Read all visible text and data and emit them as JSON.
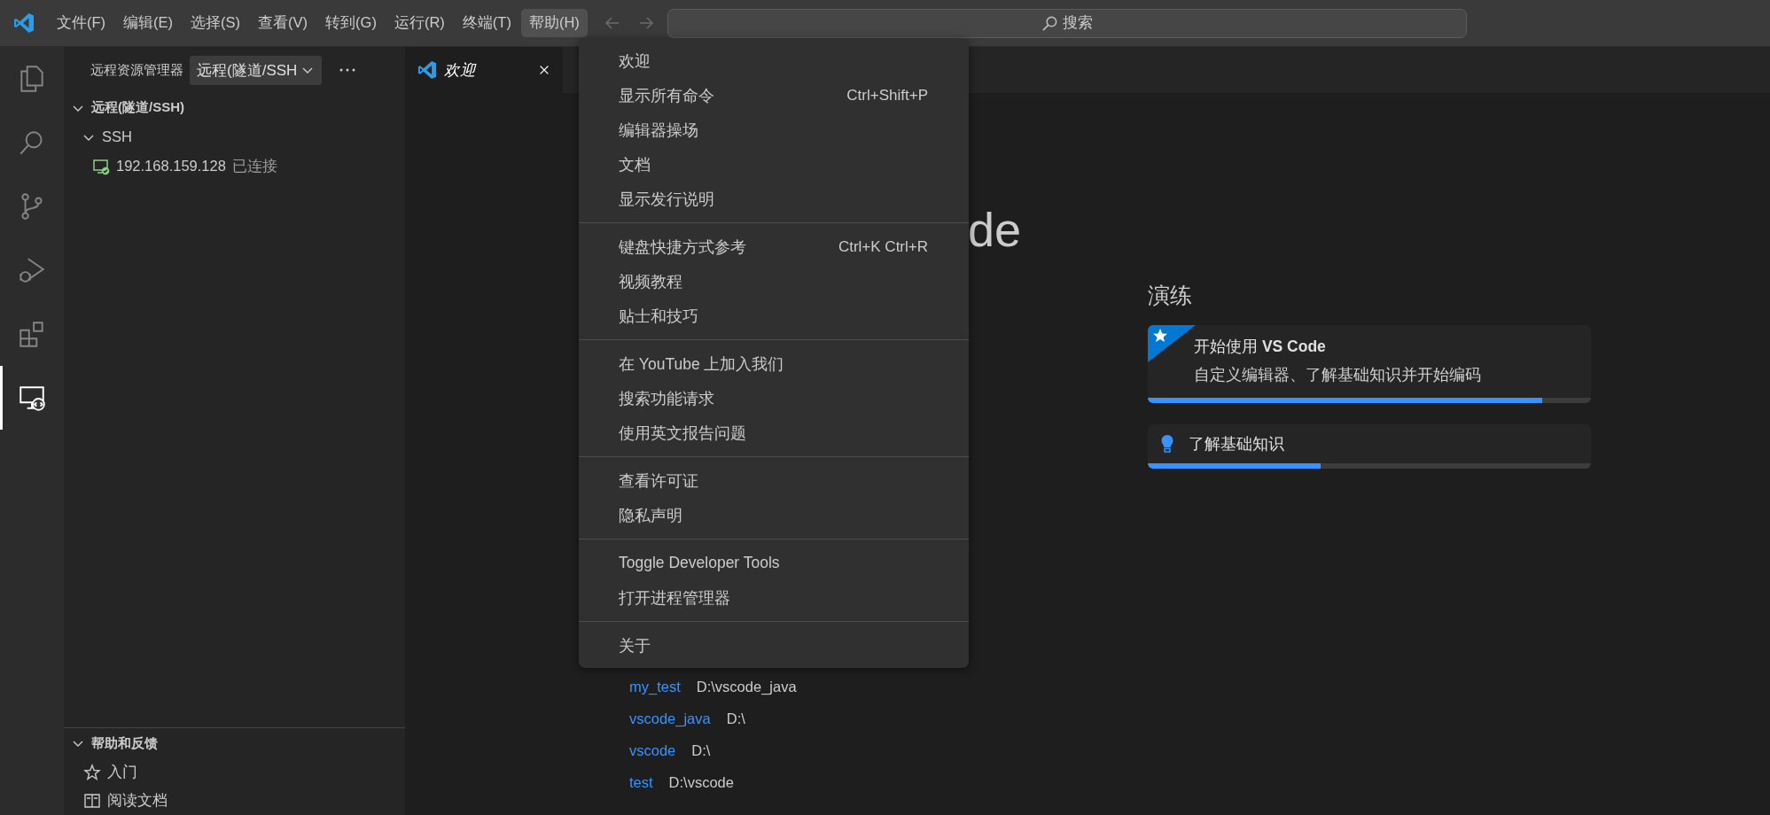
{
  "menu_bar": {
    "items": [
      {
        "label": "文件(F)",
        "selected": false
      },
      {
        "label": "编辑(E)",
        "selected": false
      },
      {
        "label": "选择(S)",
        "selected": false
      },
      {
        "label": "查看(V)",
        "selected": false
      },
      {
        "label": "转到(G)",
        "selected": false
      },
      {
        "label": "运行(R)",
        "selected": false
      },
      {
        "label": "终端(T)",
        "selected": false
      },
      {
        "label": "帮助(H)",
        "selected": true
      }
    ]
  },
  "search": {
    "placeholder": "搜索"
  },
  "activity_bar": {
    "items": [
      {
        "kind": "explorer",
        "selected": false
      },
      {
        "kind": "search",
        "selected": false
      },
      {
        "kind": "source-control",
        "selected": false
      },
      {
        "kind": "run-debug",
        "selected": false
      },
      {
        "kind": "extensions",
        "selected": false
      },
      {
        "kind": "remote",
        "selected": true
      }
    ]
  },
  "sidebar": {
    "title": "远程资源管理器",
    "dropdown": {
      "value": "远程(隧道/SSH"
    },
    "tree": [
      {
        "label": "远程(隧道/SSH)",
        "expanded": true,
        "children": [
          {
            "label": "SSH",
            "expanded": true,
            "children": [
              {
                "label": "192.168.159.128",
                "status": "已连接"
              }
            ]
          }
        ]
      }
    ],
    "help_section": {
      "title": "帮助和反馈",
      "expanded": true,
      "items": [
        {
          "kind": "star",
          "label": "入门"
        },
        {
          "kind": "book",
          "label": "阅读文档"
        }
      ]
    }
  },
  "tabs": [
    {
      "label": "欢迎",
      "selected": true
    }
  ],
  "welcome": {
    "heading": "de",
    "recent": [
      {
        "name": "my_test",
        "path": "D:\\vscode_java"
      },
      {
        "name": "vscode_java",
        "path": "D:\\"
      },
      {
        "name": "vscode",
        "path": "D:\\"
      },
      {
        "name": "test",
        "path": "D:\\vscode"
      }
    ],
    "walkthroughs": {
      "title": "演练",
      "items": [
        {
          "kind": "featured",
          "title": "开始使用 **VS Code**",
          "description": "自定义编辑器、了解基础知识并开始编码",
          "level": 0.89
        },
        {
          "kind": "tip",
          "title": "了解基础知识",
          "level": 0.39
        }
      ]
    }
  },
  "help_menu": {
    "groups": [
      [
        {
          "label": "欢迎"
        },
        {
          "label": "显示所有命令",
          "shortcut": "Ctrl+Shift+P"
        },
        {
          "label": "编辑器操场"
        },
        {
          "label": "文档"
        },
        {
          "label": "显示发行说明"
        }
      ],
      [
        {
          "label": "键盘快捷方式参考",
          "shortcut": "Ctrl+K Ctrl+R"
        },
        {
          "label": "视频教程"
        },
        {
          "label": "贴士和技巧"
        }
      ],
      [
        {
          "label": "在 YouTube 上加入我们"
        },
        {
          "label": "搜索功能请求"
        },
        {
          "label": "使用英文报告问题"
        }
      ],
      [
        {
          "label": "查看许可证"
        },
        {
          "label": "隐私声明"
        }
      ],
      [
        {
          "label": "Toggle Developer Tools"
        },
        {
          "label": "打开进程管理器"
        }
      ],
      [
        {
          "label": "关于"
        }
      ]
    ]
  }
}
